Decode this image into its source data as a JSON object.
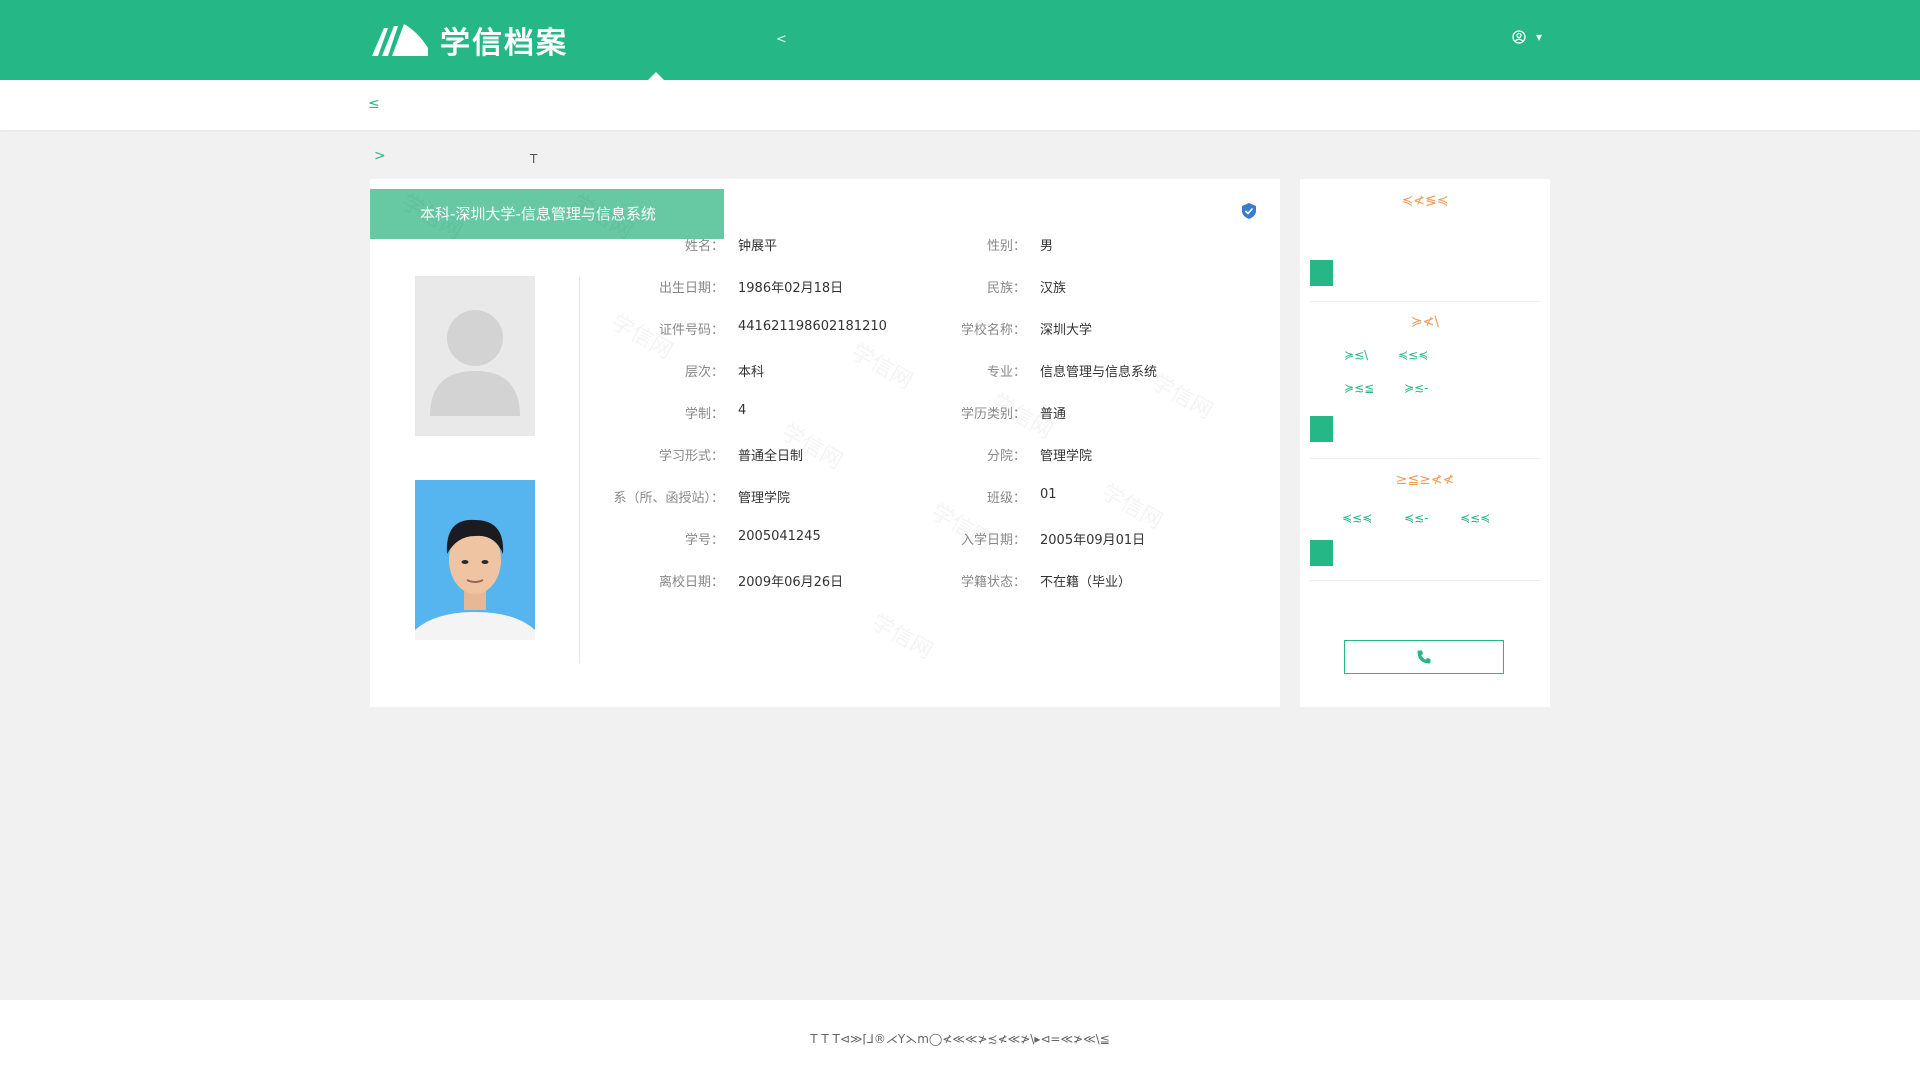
{
  "header": {
    "logo_text": "学信档案",
    "nav_glyph": "<",
    "user_caret": "▾"
  },
  "subnav": {
    "glyph": "≤"
  },
  "breadcrumb": {
    "arrow": ">",
    "tail": "T"
  },
  "record": {
    "title": "本科-深圳大学-信息管理与信息系统",
    "fields_left": [
      {
        "label": "姓名：",
        "value": "钟展平"
      },
      {
        "label": "出生日期：",
        "value": "1986年02月18日"
      },
      {
        "label": "证件号码：",
        "value": "441621198602181210"
      },
      {
        "label": "层次：",
        "value": "本科"
      },
      {
        "label": "学制：",
        "value": "4"
      },
      {
        "label": "学习形式：",
        "value": "普通全日制"
      },
      {
        "label": "系（所、函授站）：",
        "value": "管理学院"
      },
      {
        "label": "学号：",
        "value": "2005041245"
      },
      {
        "label": "离校日期：",
        "value": "2009年06月26日"
      }
    ],
    "fields_right": [
      {
        "label": "性别：",
        "value": "男"
      },
      {
        "label": "民族：",
        "value": "汉族"
      },
      {
        "label": "学校名称：",
        "value": "深圳大学"
      },
      {
        "label": "专业：",
        "value": "信息管理与信息系统"
      },
      {
        "label": "学历类别：",
        "value": "普通"
      },
      {
        "label": "分院：",
        "value": "管理学院"
      },
      {
        "label": "班级：",
        "value": "01"
      },
      {
        "label": "入学日期：",
        "value": "2005年09月01日"
      },
      {
        "label": "学籍状态：",
        "value": "不在籍（毕业）"
      }
    ],
    "watermark_text": "学信网"
  },
  "sidebar": {
    "section1_title": "≼≮≶≼",
    "section2_title": "≽≮\\",
    "section2_links": [
      "≽≲\\",
      "≼≲≼",
      "≽≲≦",
      "≽≲-"
    ],
    "section3_title": "≥≦≥≮≮",
    "section3_links": [
      "≼≲≼",
      "≼≲-",
      "≼≲≼"
    ]
  },
  "footer": {
    "text": "T T T⊲≫⌈⅃®⋌Y⋋m◯≮≪≪≯≾≮≪≯\\▸⊲=≪≯≪\\≦"
  },
  "colors": {
    "brand_green": "#25b886",
    "ribbon_green": "#67c9a4",
    "accent_orange": "#f39c5b",
    "shield_blue": "#3a7bd5"
  }
}
